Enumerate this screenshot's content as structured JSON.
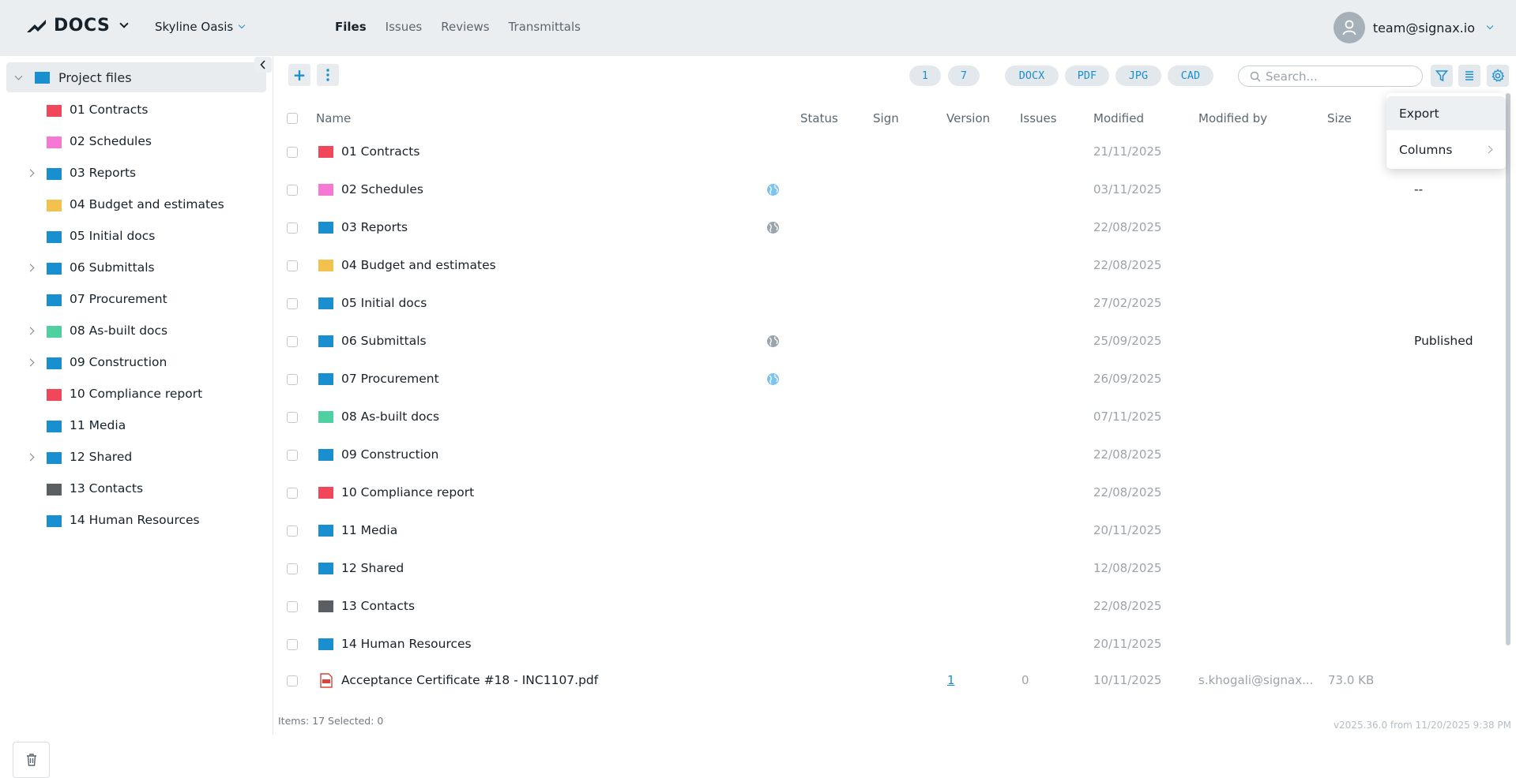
{
  "app": {
    "name": "DOCS",
    "project": "Skyline Oasis",
    "user": "team@signax.io"
  },
  "nav": {
    "tabs": [
      "Files",
      "Issues",
      "Reviews",
      "Transmittals"
    ],
    "active": "Files"
  },
  "sidebar": {
    "root": "Project files",
    "items": [
      {
        "label": "01 Contracts",
        "color": "#f0475a",
        "expandable": false
      },
      {
        "label": "02 Schedules",
        "color": "#f478d4",
        "expandable": false
      },
      {
        "label": "03 Reports",
        "color": "#1a8fd0",
        "expandable": true
      },
      {
        "label": "04 Budget and estimates",
        "color": "#f2c14e",
        "expandable": false
      },
      {
        "label": "05 Initial docs",
        "color": "#1a8fd0",
        "expandable": false
      },
      {
        "label": "06 Submittals",
        "color": "#1a8fd0",
        "expandable": true
      },
      {
        "label": "07 Procurement",
        "color": "#1a8fd0",
        "expandable": false
      },
      {
        "label": "08 As-built docs",
        "color": "#4fd0a0",
        "expandable": true
      },
      {
        "label": "09 Construction",
        "color": "#1a8fd0",
        "expandable": true
      },
      {
        "label": "10 Compliance report",
        "color": "#f0475a",
        "expandable": false
      },
      {
        "label": "11 Media",
        "color": "#1a8fd0",
        "expandable": false
      },
      {
        "label": "12 Shared",
        "color": "#1a8fd0",
        "expandable": true
      },
      {
        "label": "13 Contacts",
        "color": "#5a5f63",
        "expandable": false
      },
      {
        "label": "14 Human Resources",
        "color": "#1a8fd0",
        "expandable": false
      }
    ]
  },
  "toolbar": {
    "counts": [
      "1",
      "7"
    ],
    "filters": [
      "DOCX",
      "PDF",
      "JPG",
      "CAD"
    ],
    "search_placeholder": "Search..."
  },
  "table": {
    "columns": [
      "Name",
      "Status",
      "Sign",
      "Version",
      "Issues",
      "Modified",
      "Modified by",
      "Size"
    ],
    "rows": [
      {
        "name": "01 Contracts",
        "color": "#f0475a",
        "globe": "",
        "modified": "21/11/2025",
        "extra": ""
      },
      {
        "name": "02 Schedules",
        "color": "#f478d4",
        "globe": "blue",
        "modified": "03/11/2025",
        "extra": "--"
      },
      {
        "name": "03 Reports",
        "color": "#1a8fd0",
        "globe": "gray",
        "modified": "22/08/2025",
        "extra": ""
      },
      {
        "name": "04 Budget and estimates",
        "color": "#f2c14e",
        "globe": "",
        "modified": "22/08/2025",
        "extra": ""
      },
      {
        "name": "05 Initial docs",
        "color": "#1a8fd0",
        "globe": "",
        "modified": "27/02/2025",
        "extra": ""
      },
      {
        "name": "06 Submittals",
        "color": "#1a8fd0",
        "globe": "gray",
        "modified": "25/09/2025",
        "extra": "Published"
      },
      {
        "name": "07 Procurement",
        "color": "#1a8fd0",
        "globe": "blue",
        "modified": "26/09/2025",
        "extra": ""
      },
      {
        "name": "08 As-built docs",
        "color": "#4fd0a0",
        "globe": "",
        "modified": "07/11/2025",
        "extra": ""
      },
      {
        "name": "09 Construction",
        "color": "#1a8fd0",
        "globe": "",
        "modified": "22/08/2025",
        "extra": ""
      },
      {
        "name": "10 Compliance report",
        "color": "#f0475a",
        "globe": "",
        "modified": "22/08/2025",
        "extra": ""
      },
      {
        "name": "11 Media",
        "color": "#1a8fd0",
        "globe": "",
        "modified": "20/11/2025",
        "extra": ""
      },
      {
        "name": "12 Shared",
        "color": "#1a8fd0",
        "globe": "",
        "modified": "12/08/2025",
        "extra": ""
      },
      {
        "name": "13 Contacts",
        "color": "#5a5f63",
        "globe": "",
        "modified": "22/08/2025",
        "extra": ""
      },
      {
        "name": "14 Human Resources",
        "color": "#1a8fd0",
        "globe": "",
        "modified": "20/11/2025",
        "extra": ""
      }
    ],
    "file_row": {
      "name": "Acceptance Certificate #18 - INC1107.pdf",
      "version": "1",
      "issues": "0",
      "modified": "10/11/2025",
      "modified_by": "s.khogali@signax...",
      "size": "73.0 KB",
      "icon": "pdf-icon"
    }
  },
  "menu": {
    "export": "Export",
    "columns": "Columns"
  },
  "footer": {
    "status": "Items: 17 Selected: 0",
    "version": "v2025.36.0 from 11/20/2025 9:38 PM"
  },
  "colors": {
    "accent": "#1a8fd0",
    "topbar": "#eaeef1"
  }
}
